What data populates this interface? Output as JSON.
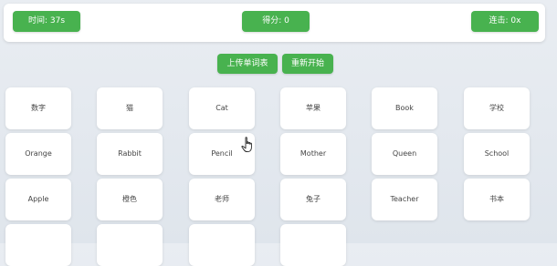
{
  "status": {
    "timer": "时间: 37s",
    "score": "得分: 0",
    "streak": "连击: 0x"
  },
  "buttons": {
    "upload": "上传单词表",
    "restart": "重新开始"
  },
  "cards": [
    "数字",
    "猫",
    "Cat",
    "苹果",
    "Book",
    "学校",
    "Orange",
    "Rabbit",
    "Pencil",
    "Mother",
    "Queen",
    "School",
    "Apple",
    "橙色",
    "老师",
    "兔子",
    "Teacher",
    "书本",
    "",
    "",
    "",
    ""
  ],
  "icons": {
    "cursor": "hand-pointer-icon"
  },
  "colors": {
    "accent": "#48b24f",
    "card": "#ffffff",
    "background": "#e4e9ef"
  }
}
